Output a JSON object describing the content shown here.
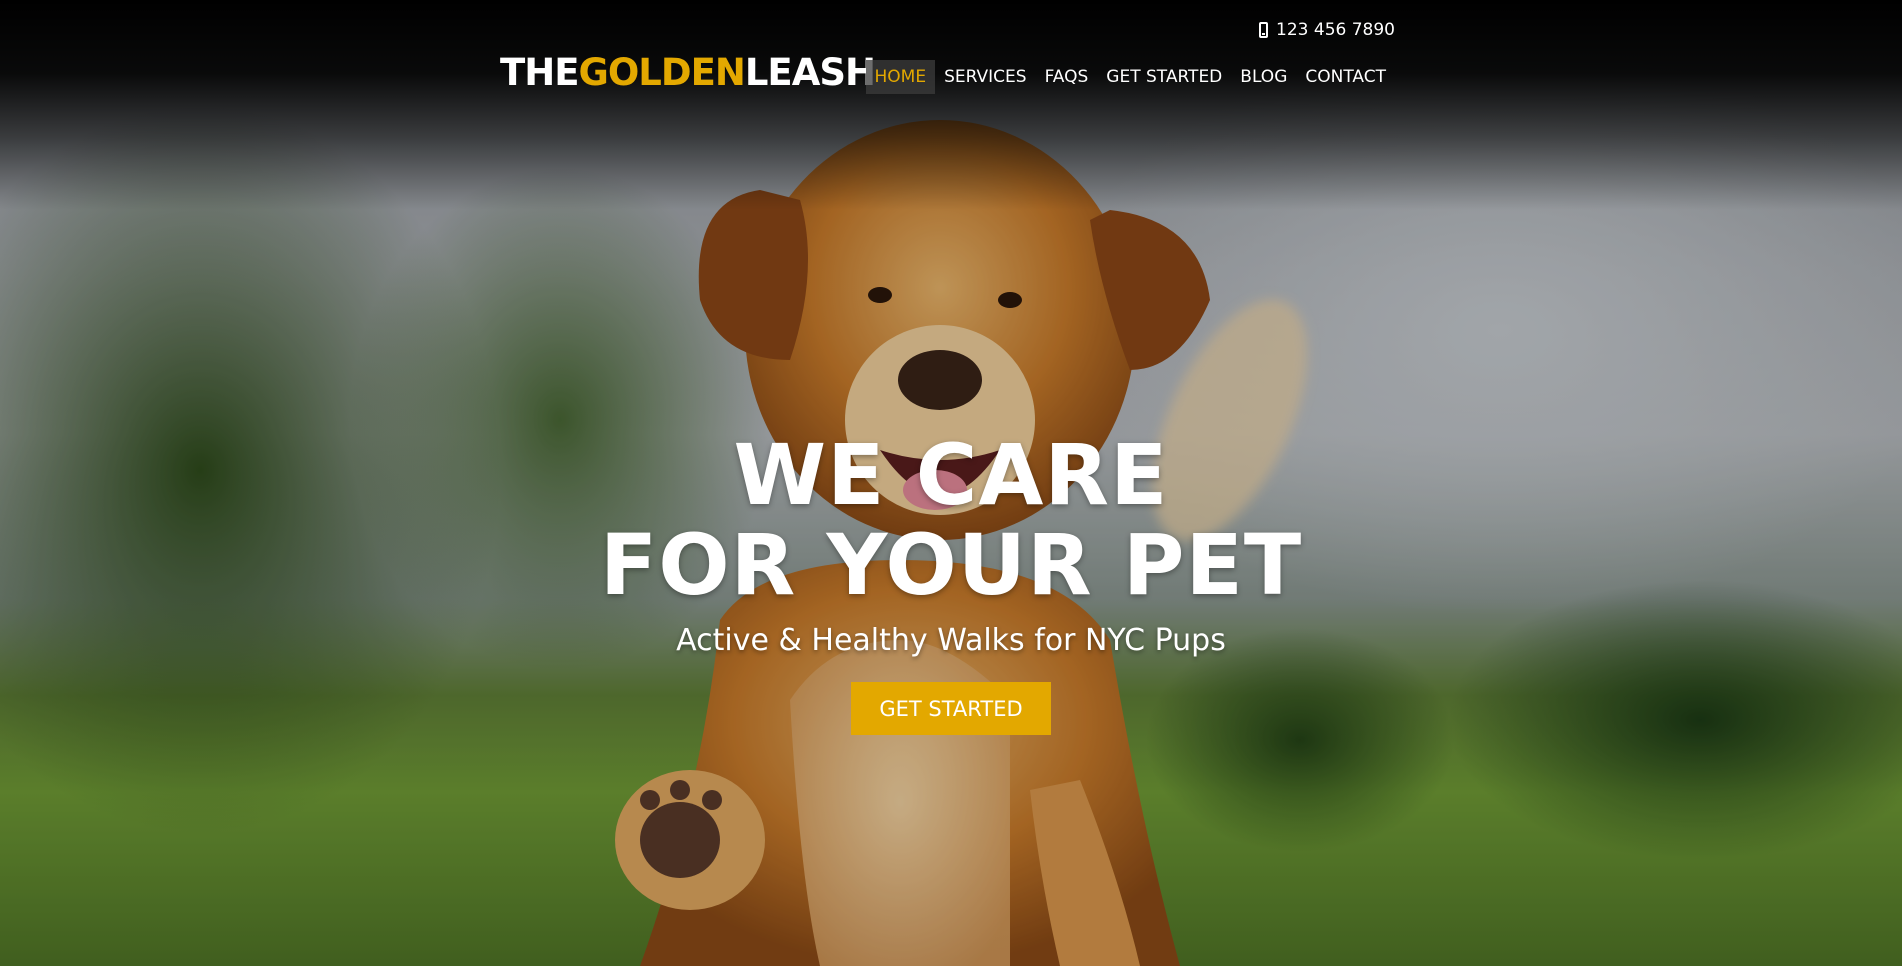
{
  "header": {
    "phone_number": "123 456 7890",
    "logo": {
      "part1": "THE",
      "part2": "GOLDEN",
      "part3": "LEASH"
    },
    "nav": [
      {
        "label": "HOME",
        "active": true
      },
      {
        "label": "SERVICES",
        "active": false
      },
      {
        "label": "FAQS",
        "active": false
      },
      {
        "label": "GET STARTED",
        "active": false
      },
      {
        "label": "BLOG",
        "active": false
      },
      {
        "label": "CONTACT",
        "active": false
      }
    ]
  },
  "hero": {
    "headline_line1": "WE CARE",
    "headline_line2": "FOR YOUR PET",
    "subheadline": "Active & Healthy Walks for NYC Pups",
    "cta_label": "GET STARTED"
  },
  "colors": {
    "accent": "#e3a800",
    "text": "#ffffff",
    "header_bg": "#000000"
  },
  "icons": {
    "phone": "mobile-phone-icon"
  }
}
